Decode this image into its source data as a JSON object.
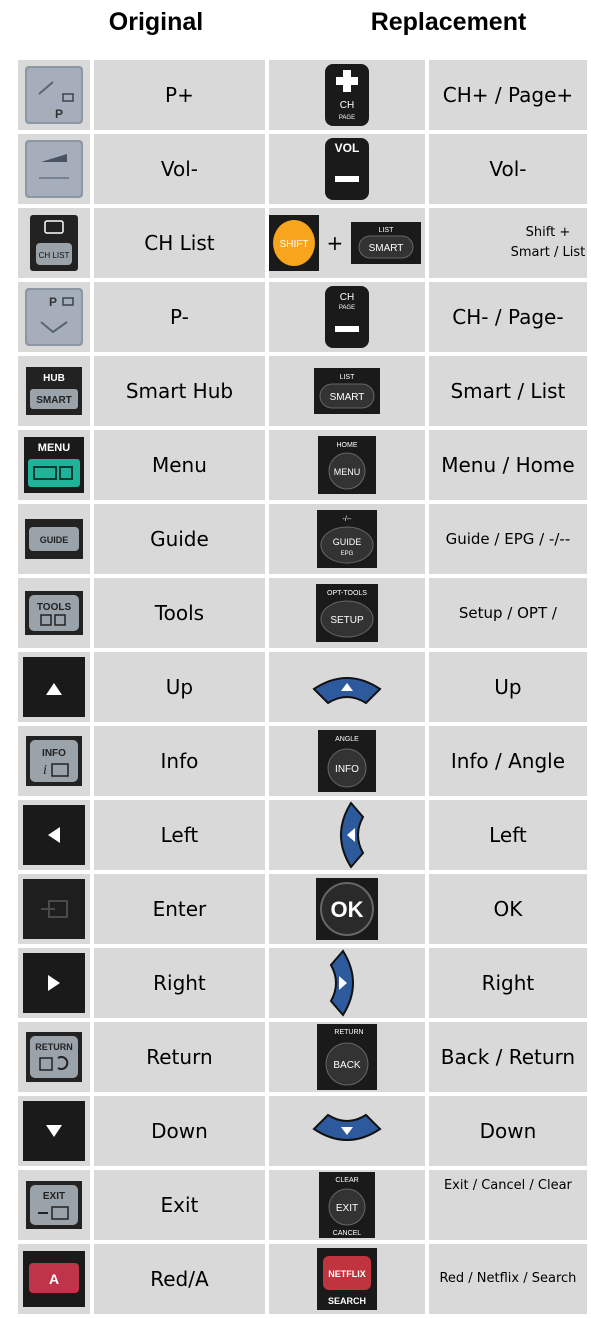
{
  "headers": {
    "original": "Original",
    "replacement": "Replacement"
  },
  "rows": [
    {
      "original": "P+",
      "replacement": "CH+ / Page+",
      "orig_icon": "p-plus-button",
      "repl_icon": "ch-page-plus-button"
    },
    {
      "original": "Vol-",
      "replacement": "Vol-",
      "orig_icon": "vol-minus-button",
      "repl_icon": "vol-minus-button"
    },
    {
      "original": "CH List",
      "replacement": "Shift + Smart / List",
      "orig_icon": "ch-list-button",
      "repl_icon": "shift-smart-buttons"
    },
    {
      "original": "P-",
      "replacement": "CH- / Page-",
      "orig_icon": "p-minus-button",
      "repl_icon": "ch-page-minus-button"
    },
    {
      "original": "Smart Hub",
      "replacement": "Smart / List",
      "orig_icon": "smart-hub-button",
      "repl_icon": "smart-list-button"
    },
    {
      "original": "Menu",
      "replacement": "Menu / Home",
      "orig_icon": "menu-button",
      "repl_icon": "menu-home-button"
    },
    {
      "original": "Guide",
      "replacement": "Guide / EPG / -/--",
      "orig_icon": "guide-button",
      "repl_icon": "guide-epg-button"
    },
    {
      "original": "Tools",
      "replacement": "Setup / OPT /",
      "orig_icon": "tools-button",
      "repl_icon": "setup-opt-button"
    },
    {
      "original": "Up",
      "replacement": "Up",
      "orig_icon": "up-arrow-button",
      "repl_icon": "up-dpad-button"
    },
    {
      "original": "Info",
      "replacement": "Info / Angle",
      "orig_icon": "info-button",
      "repl_icon": "info-angle-button"
    },
    {
      "original": "Left",
      "replacement": "Left",
      "orig_icon": "left-arrow-button",
      "repl_icon": "left-dpad-button"
    },
    {
      "original": "Enter",
      "replacement": "OK",
      "orig_icon": "enter-button",
      "repl_icon": "ok-button"
    },
    {
      "original": "Right",
      "replacement": "Right",
      "orig_icon": "right-arrow-button",
      "repl_icon": "right-dpad-button"
    },
    {
      "original": "Return",
      "replacement": "Back / Return",
      "orig_icon": "return-button",
      "repl_icon": "back-return-button"
    },
    {
      "original": "Down",
      "replacement": "Down",
      "orig_icon": "down-arrow-button",
      "repl_icon": "down-dpad-button"
    },
    {
      "original": "Exit",
      "replacement": "Exit / Cancel / Clear",
      "orig_icon": "exit-button",
      "repl_icon": "exit-cancel-clear-button"
    },
    {
      "original": "Red/A",
      "replacement": "Red / Netflix / Search",
      "orig_icon": "red-a-button",
      "repl_icon": "netflix-search-button"
    }
  ],
  "icon_text": {
    "p": "P",
    "ch": "CH",
    "page": "PAGE",
    "vol": "VOL",
    "chlist": "CH LIST",
    "shift": "SHIFT",
    "plus": "+",
    "list": "LIST",
    "smart": "SMART",
    "hub": "HUB",
    "menu": "MENU",
    "home": "HOME",
    "guide": "GUIDE",
    "epg": "EPG",
    "dash": "-/--",
    "tools": "TOOLS",
    "opt_tools": "OPT-TOOLS",
    "setup": "SETUP",
    "info": "INFO",
    "angle": "ANGLE",
    "ok": "OK",
    "return": "RETURN",
    "back": "BACK",
    "exit": "EXIT",
    "clear": "CLEAR",
    "cancel": "CANCEL",
    "a": "A",
    "netflix": "NETFLIX",
    "search": "SEARCH"
  },
  "colors": {
    "cell_bg": "#d9d9d9",
    "shift_orange": "#f7a51c",
    "menu_teal": "#1fb39a",
    "dpad_blue": "#2c5a9c",
    "red_a": "#c0344a",
    "netflix_red": "#c0343f"
  }
}
